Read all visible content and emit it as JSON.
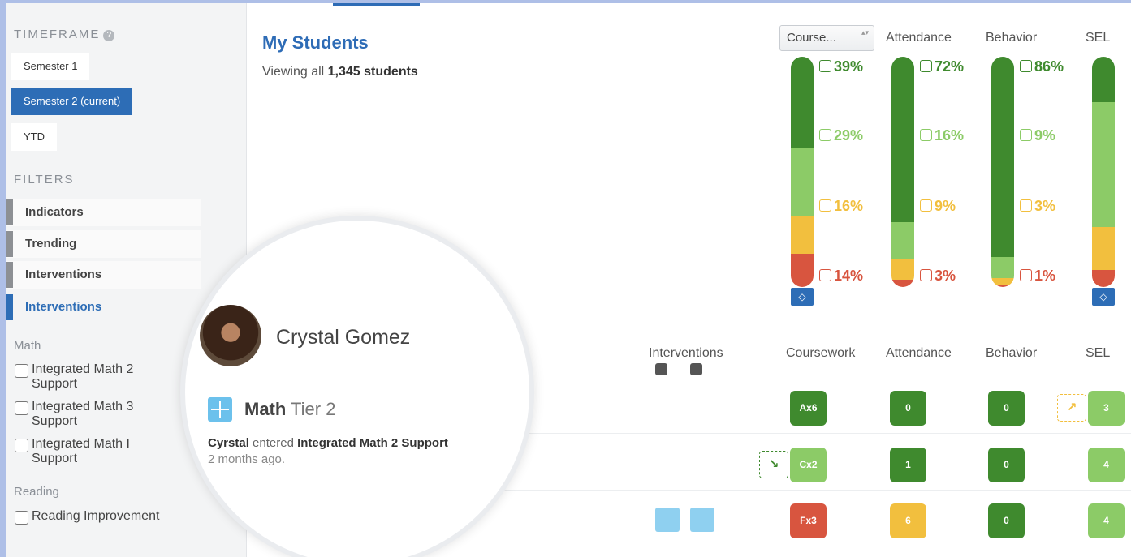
{
  "sidebar": {
    "timeframe_title": "TIMEFRAME",
    "help_glyph": "?",
    "timeframes": [
      {
        "label": "Semester 1",
        "active": false
      },
      {
        "label": "Semester 2 (current)",
        "active": true
      },
      {
        "label": "YTD",
        "active": false
      }
    ],
    "filters_title": "FILTERS",
    "filters": [
      {
        "label": "Indicators",
        "active": false
      },
      {
        "label": "Trending",
        "active": false
      },
      {
        "label": "Interventions",
        "active": false
      },
      {
        "label": "Interventions",
        "active": true
      }
    ],
    "groups": [
      {
        "label": "Math",
        "options": [
          "Integrated Math 2 Support",
          "Integrated Math 3 Support",
          "Integrated Math I Support"
        ]
      },
      {
        "label": "Reading",
        "options": [
          "Reading Improvement"
        ]
      }
    ]
  },
  "main": {
    "title": "My Students",
    "subtitle_prefix": "Viewing all",
    "subtitle_count": "1,345 students",
    "course_select": {
      "value": "Course...",
      "arrow_glyph": "▴▾"
    },
    "summary_headers": [
      "Attendance",
      "Behavior",
      "SEL"
    ],
    "summary": [
      {
        "name": "Course",
        "percents": [
          "39%",
          "29%",
          "16%",
          "14%"
        ],
        "fractions": [
          0.39,
          0.29,
          0.16,
          0.14
        ]
      },
      {
        "name": "Attendance",
        "percents": [
          "72%",
          "16%",
          "9%",
          "3%"
        ],
        "fractions": [
          0.72,
          0.16,
          0.09,
          0.03
        ]
      },
      {
        "name": "Behavior",
        "percents": [
          "86%",
          "9%",
          "3%",
          "1%"
        ],
        "fractions": [
          0.86,
          0.09,
          0.03,
          0.01
        ]
      },
      {
        "name": "SEL",
        "percents": [
          "",
          "",
          "",
          ""
        ],
        "fractions": [
          0.19,
          0.52,
          0.18,
          0.07
        ]
      }
    ],
    "level_colors": [
      "#3f8a2e",
      "#8ccb67",
      "#f2bf3e",
      "#d8553f"
    ],
    "eye_glyph": "◇",
    "table_headers": {
      "interventions": "Interventions",
      "coursework": "Coursework",
      "attendance": "Attendance",
      "behavior": "Behavior",
      "sel": "SEL"
    },
    "rows": [
      {
        "coursework": "Ax6",
        "attendance": "0",
        "behavior": "0",
        "sel": "3",
        "trend": "↗",
        "trend_col": "sel"
      },
      {
        "coursework": "Cx2",
        "attendance": "1",
        "behavior": "0",
        "sel": "4",
        "trend": "↘",
        "trend_col": "coursework"
      },
      {
        "coursework": "Fx3",
        "attendance": "6",
        "behavior": "0",
        "sel": "4",
        "trend": "",
        "trend_col": ""
      }
    ],
    "cell_colors": {
      "Ax6": "#3f8a2e",
      "Cx2": "#8ccb67",
      "Fx3": "#d8553f",
      "att_0": "#3f8a2e",
      "att_1": "#3f8a2e",
      "att_6": "#f2bf3e",
      "beh_0": "#3f8a2e",
      "sel_3": "#8ccb67",
      "sel_4": "#8ccb67"
    }
  },
  "magnifier": {
    "student_name": "Crystal Gomez",
    "subject": "Math",
    "tier": "Tier 2",
    "actor": "Cyrstal",
    "action": "entered",
    "program": "Integrated Math 2 Support",
    "when": "2 months ago."
  }
}
